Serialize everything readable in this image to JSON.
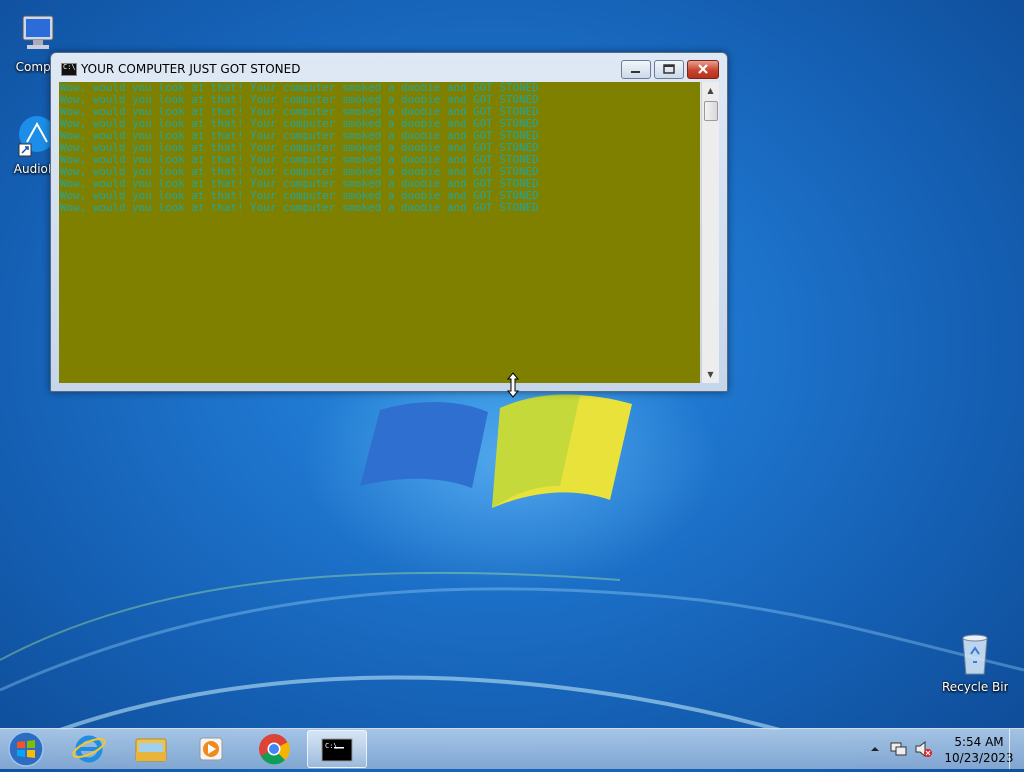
{
  "desktop": {
    "icons": [
      {
        "label": "Compu"
      },
      {
        "label": "AudioR"
      },
      {
        "label": "Recycle Bin"
      }
    ]
  },
  "window": {
    "title": "YOUR COMPUTER JUST GOT STONED",
    "console_lines": [
      "Wow, would you look at that! Your computer smoked a doobie and GOT STONED",
      "Wow, would you look at that! Your computer smoked a doobie and GOT STONED",
      "Wow, would you look at that! Your computer smoked a doobie and GOT STONED",
      "Wow, would you look at that! Your computer smoked a doobie and GOT STONED",
      "Wow, would you look at that! Your computer smoked a doobie and GOT STONED",
      "Wow, would you look at that! Your computer smoked a doobie and GOT STONED",
      "Wow, would you look at that! Your computer smoked a doobie and GOT STONED",
      "Wow, would you look at that! Your computer smoked a doobie and GOT STONED",
      "Wow, would you look at that! Your computer smoked a doobie and GOT STONED",
      "Wow, would you look at that! Your computer smoked a doobie and GOT STONED",
      "Wow, would you look at that! Your computer smoked a doobie and GOT STONED"
    ],
    "colors": {
      "console_bg": "#808000",
      "console_text": "#1ba6a6"
    }
  },
  "taskbar": {
    "pinned": [
      {
        "name": "internet-explorer-icon"
      },
      {
        "name": "windows-explorer-icon"
      },
      {
        "name": "media-player-icon"
      },
      {
        "name": "chrome-icon"
      },
      {
        "name": "command-prompt-icon"
      }
    ],
    "clock": {
      "time": "5:54 AM",
      "date": "10/23/2023"
    }
  }
}
